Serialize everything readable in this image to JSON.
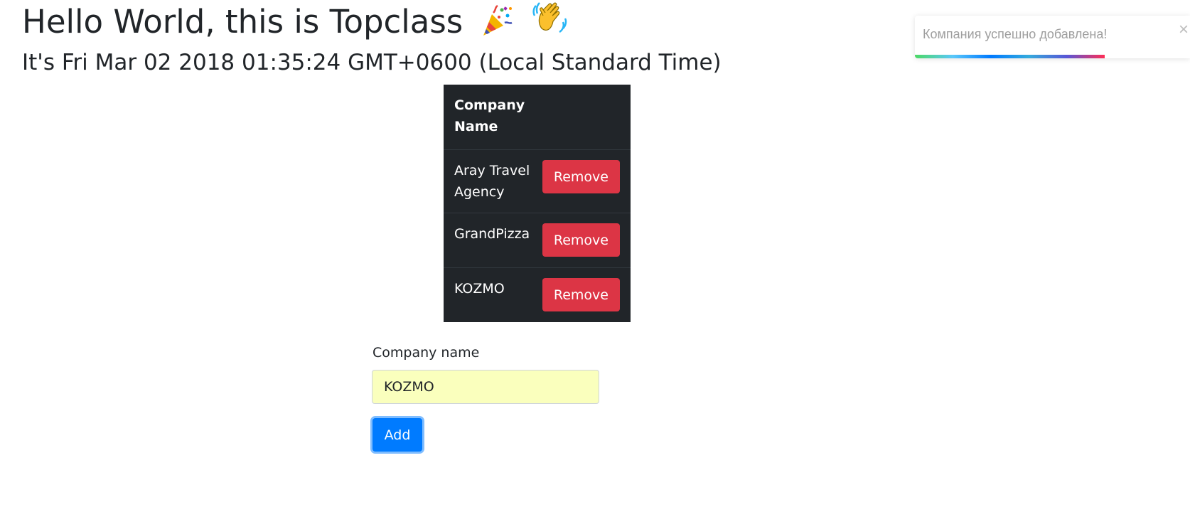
{
  "header": {
    "title": "Hello World, this is Topclass",
    "subtitle": "It's Fri Mar 02 2018 01:35:24 GMT+0600 (Local Standard Time)"
  },
  "table": {
    "column_header": "Company Name",
    "rows": [
      {
        "name": "Aray Travel Agency",
        "action_label": "Remove"
      },
      {
        "name": "GrandPizza",
        "action_label": "Remove"
      },
      {
        "name": "KOZMO",
        "action_label": "Remove"
      }
    ]
  },
  "form": {
    "label": "Company name",
    "input_value": "KOZMO",
    "submit_label": "Add"
  },
  "toast": {
    "message": "Компания успешно добавлена!",
    "close_glyph": "×",
    "progress": 0.69
  },
  "icons": {
    "party": "party-popper-icon",
    "wave": "waving-hand-icon"
  },
  "colors": {
    "table_bg": "#212529",
    "danger": "#dc3545",
    "primary": "#007bff",
    "autofill": "#faffbd"
  }
}
